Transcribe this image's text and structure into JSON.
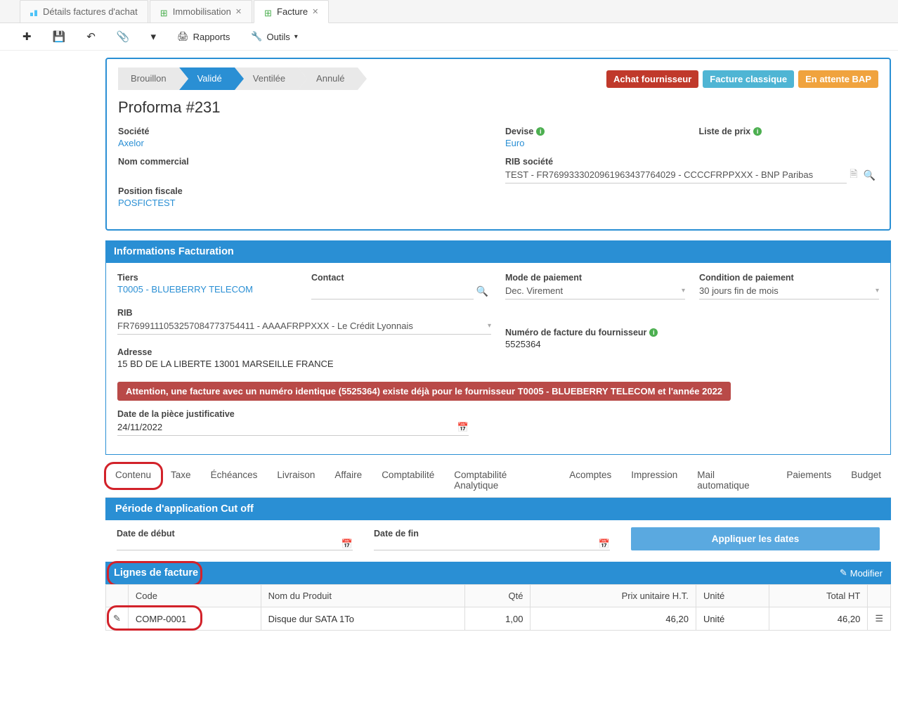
{
  "tabs": [
    {
      "label": "Détails factures d'achat"
    },
    {
      "label": "Immobilisation"
    },
    {
      "label": "Facture"
    }
  ],
  "toolbar": {
    "reports": "Rapports",
    "tools": "Outils"
  },
  "status": {
    "steps": [
      "Brouillon",
      "Validé",
      "Ventilée",
      "Annulé"
    ],
    "badges": [
      {
        "label": "Achat fournisseur",
        "color": "#c0392b"
      },
      {
        "label": "Facture classique",
        "color": "#4fb5d4"
      },
      {
        "label": "En attente BAP",
        "color": "#f0a33e"
      }
    ]
  },
  "title": "Proforma #231",
  "header": {
    "societe_label": "Société",
    "societe": "Axelor",
    "nom_commercial_label": "Nom commercial",
    "position_fiscale_label": "Position fiscale",
    "position_fiscale": "POSFICTEST",
    "devise_label": "Devise",
    "devise": "Euro",
    "rib_societe_label": "RIB société",
    "rib_societe": "TEST - FR7699333020961963437764029 - CCCCFRPPXXX - BNP Paribas",
    "liste_prix_label": "Liste de prix"
  },
  "info": {
    "section": "Informations Facturation",
    "tiers_label": "Tiers",
    "tiers": "T0005 - BLUEBERRY TELECOM",
    "contact_label": "Contact",
    "rib_label": "RIB",
    "rib": "FR7699111053257084773754411 - AAAAFRPPXXX - Le Crédit Lyonnais",
    "adresse_label": "Adresse",
    "adresse": "15 BD DE LA LIBERTE 13001 MARSEILLE FRANCE",
    "mode_label": "Mode de paiement",
    "mode": "Dec. Virement",
    "cond_label": "Condition de paiement",
    "cond": "30 jours fin de mois",
    "num_fact_label": "Numéro de facture du fournisseur",
    "num_fact": "5525364",
    "alert": "Attention, une facture avec un numéro identique (5525364) existe déjà pour le fournisseur T0005 - BLUEBERRY TELECOM et l'année 2022",
    "date_piece_label": "Date de la pièce justificative",
    "date_piece": "24/11/2022"
  },
  "subtabs": [
    "Contenu",
    "Taxe",
    "Échéances",
    "Livraison",
    "Affaire",
    "Comptabilité",
    "Comptabilité Analytique",
    "Acomptes",
    "Impression",
    "Mail automatique",
    "Paiements",
    "Budget"
  ],
  "cutoff": {
    "section": "Période d'application Cut off",
    "debut_label": "Date de début",
    "fin_label": "Date de fin",
    "apply": "Appliquer les dates"
  },
  "lines": {
    "section": "Lignes de facture",
    "modify": "Modifier",
    "cols": {
      "code": "Code",
      "produit": "Nom du Produit",
      "qte": "Qté",
      "pu": "Prix unitaire H.T.",
      "unite": "Unité",
      "total": "Total HT"
    },
    "rows": [
      {
        "code": "COMP-0001",
        "produit": "Disque dur SATA 1To",
        "qte": "1,00",
        "pu": "46,20",
        "unite": "Unité",
        "total": "46,20"
      }
    ]
  }
}
